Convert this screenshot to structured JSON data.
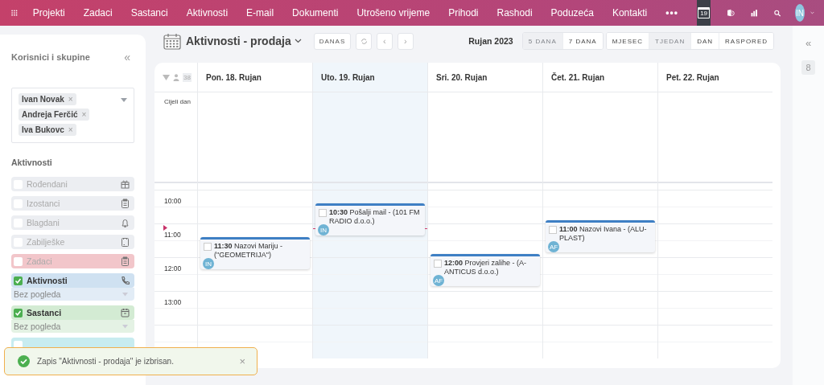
{
  "top_nav": {
    "items": [
      {
        "label": "Projekti"
      },
      {
        "label": "Zadaci"
      },
      {
        "label": "Sastanci"
      },
      {
        "label": "Aktivnosti"
      },
      {
        "label": "E-mail"
      },
      {
        "label": "Dokumenti"
      },
      {
        "label": "Utrošeno vrijeme"
      },
      {
        "label": "Prihodi"
      },
      {
        "label": "Rashodi"
      },
      {
        "label": "Poduzeća"
      },
      {
        "label": "Kontakti"
      }
    ],
    "more": "•••",
    "calendar_day": "19",
    "avatar": "IN"
  },
  "sidebar": {
    "title": "Korisnici i skupine",
    "collapse": "«",
    "users": [
      {
        "name": "Ivan Novak"
      },
      {
        "name": "Andreja Ferčić"
      },
      {
        "name": "Iva Bukovc"
      }
    ],
    "chip_remove": "×",
    "section": "Aktivnosti",
    "items": [
      {
        "label": "Rođendani",
        "checked": false,
        "color": "#eceef2"
      },
      {
        "label": "Izostanci",
        "checked": false,
        "color": "#eceef2"
      },
      {
        "label": "Blagdani",
        "checked": false,
        "color": "#eceef2"
      },
      {
        "label": "Zabilješke",
        "checked": false,
        "color": "#eceef2"
      },
      {
        "label": "Zadaci",
        "checked": false,
        "color": "#f2c6ca"
      },
      {
        "label": "Aktivnosti",
        "checked": true,
        "color": "#cfe1f1",
        "view": "Bez pogleda"
      },
      {
        "label": "Sastanci",
        "checked": true,
        "color": "#d3ebd3",
        "view": "Bez pogleda"
      },
      {
        "checked": false,
        "color": "#c8ecf0"
      }
    ]
  },
  "toolbar": {
    "title": "Aktivnosti - prodaja",
    "today": "DANAS",
    "prev": "‹",
    "next": "›",
    "period": "Rujan 2023",
    "range_buttons": [
      {
        "label": "5 DANA",
        "selected": true
      },
      {
        "label": "7 DANA",
        "selected": false
      }
    ],
    "view_buttons": [
      {
        "label": "MJESEC",
        "selected": false
      },
      {
        "label": "TJEDAN",
        "selected": true
      },
      {
        "label": "DAN",
        "selected": false
      },
      {
        "label": "RASPORED",
        "selected": false
      }
    ]
  },
  "calendar": {
    "count": "38",
    "all_day": "Cijeli dan",
    "hours": [
      "10:00",
      "11:00",
      "12:00",
      "13:00"
    ],
    "days": [
      {
        "label": "Pon. 18. Rujan",
        "today": false,
        "events": [
          {
            "time": "11:30",
            "title": "Nazovi Mariju - (\"GEOMETRIJA\")",
            "owner": "IN"
          }
        ]
      },
      {
        "label": "Uto. 19. Rujan",
        "today": true,
        "events": [
          {
            "time": "10:30",
            "title": "Pošalji mail - (101 FM RADIO d.o.o.)",
            "owner": "IN"
          }
        ]
      },
      {
        "label": "Sri. 20. Rujan",
        "today": false,
        "events": [
          {
            "time": "12:00",
            "title": "Provjeri zalihe - (A-ANTICUS d.o.o.)",
            "owner": "AF"
          }
        ]
      },
      {
        "label": "Čet. 21. Rujan",
        "today": false,
        "events": [
          {
            "time": "11:00",
            "title": "Nazovi Ivana - (ALU-PLAST)",
            "owner": "AF"
          }
        ]
      },
      {
        "label": "Pet. 22. Rujan",
        "today": false
      }
    ]
  },
  "right_rail": {
    "collapse": "«",
    "badge": "8"
  },
  "toast": {
    "message": "Zapis \"Aktivnosti - prodaja\" je izbrisan.",
    "close": "×"
  }
}
